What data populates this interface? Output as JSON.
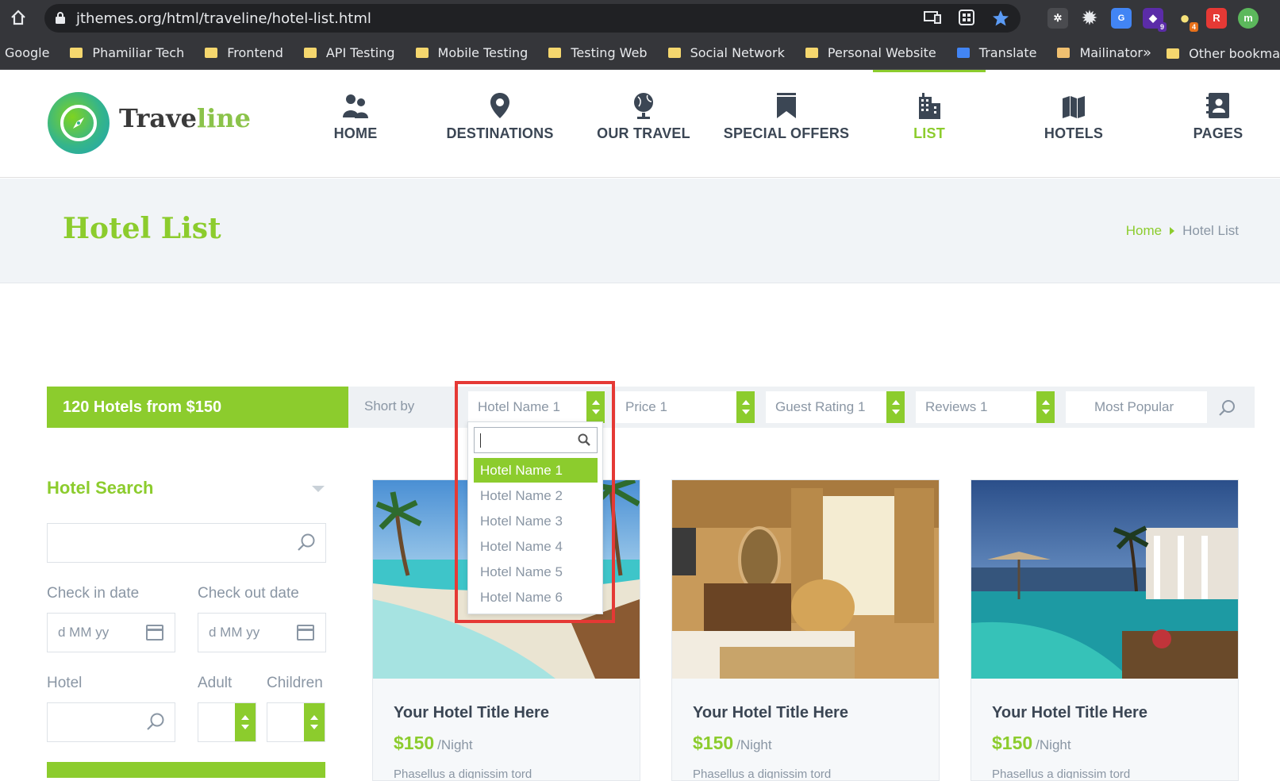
{
  "browser": {
    "url": "jthemes.org/html/traveline/hotel-list.html",
    "bookmarks": [
      "Google",
      "Phamiliar Tech",
      "Frontend",
      "API Testing",
      "Mobile Testing",
      "Testing Web",
      "Social Network",
      "Personal Website",
      "Translate",
      "Mailinator"
    ],
    "other_bookmarks": "Other bookma",
    "overflow": "»",
    "extension_badges": [
      "9",
      "4"
    ]
  },
  "logo": {
    "text_main": "Travel",
    "text_accent": "ine",
    "text_l": "l"
  },
  "nav": [
    {
      "label": "HOME",
      "icon": "people-icon"
    },
    {
      "label": "DESTINATIONS",
      "icon": "map-pin-icon"
    },
    {
      "label": "OUR TRAVEL",
      "icon": "globe-icon"
    },
    {
      "label": "SPECIAL OFFERS",
      "icon": "bookmark-icon"
    },
    {
      "label": "LIST",
      "icon": "building-icon",
      "active": true
    },
    {
      "label": "HOTELS",
      "icon": "map-icon"
    },
    {
      "label": "PAGES",
      "icon": "contact-book-icon"
    }
  ],
  "page": {
    "title": "Hotel List",
    "breadcrumb": {
      "home": "Home",
      "current": "Hotel List"
    }
  },
  "sortbar": {
    "count": "120 Hotels from $150",
    "sort_label": "Short by",
    "hotel_select": "Hotel Name 1",
    "price_select": "Price 1",
    "rating_select": "Guest Rating 1",
    "reviews_select": "Reviews 1",
    "popular_select": "Most Popular"
  },
  "dropdown": {
    "options": [
      "Hotel Name 1",
      "Hotel Name 2",
      "Hotel Name 3",
      "Hotel Name 4",
      "Hotel Name 5",
      "Hotel Name 6"
    ],
    "selected": "Hotel Name 1"
  },
  "sidebar": {
    "title": "Hotel Search",
    "checkin_label": "Check in date",
    "checkout_label": "Check out date",
    "checkin_placeholder": "d MM yy",
    "checkout_placeholder": "d MM yy",
    "hotel_label": "Hotel",
    "adult_label": "Adult",
    "children_label": "Children"
  },
  "cards": [
    {
      "title": "Your Hotel Title Here",
      "price": "$150",
      "unit": "/Night",
      "desc": "Phasellus a dignissim tord"
    },
    {
      "title": "Your Hotel Title Here",
      "price": "$150",
      "unit": "/Night",
      "desc": "Phasellus a dignissim tord"
    },
    {
      "title": "Your Hotel Title Here",
      "price": "$150",
      "unit": "/Night",
      "desc": "Phasellus a dignissim tord"
    }
  ],
  "colors": {
    "accent": "#8ccc2d",
    "highlight": "#e53935",
    "text": "#3b4654",
    "muted": "#8a96a4"
  }
}
